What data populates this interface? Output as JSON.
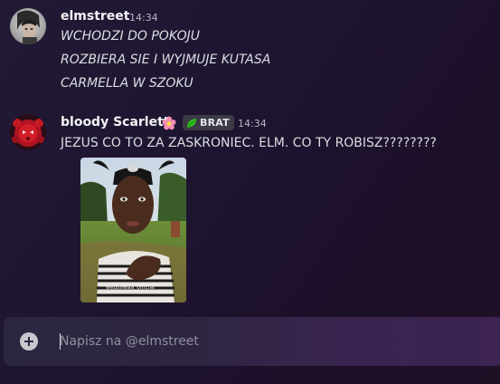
{
  "messages": [
    {
      "author": "elmstreet",
      "time": "14:34",
      "lines": [
        "WCHODZI DO POKOJU",
        "ROZBIERA SIE I WYJMUJE KUTASA",
        "CARMELLA W SZOKU"
      ]
    },
    {
      "author": "bloody Scarlett",
      "time": "14:34",
      "decoration_icon": "flower-icon",
      "tag": {
        "icon": "leaf-icon",
        "label": "BRAT",
        "color": "#2ec41a"
      },
      "lines": [
        "JEZUS CO TO ZA ZASKRONIEC. ELM. CO TY ROBISZ????????"
      ],
      "attachment": {
        "kind": "image",
        "watermark": "wedsilwaa_official"
      }
    }
  ],
  "composer": {
    "placeholder": "Napisz na @elmstreet",
    "value": "",
    "add_icon": "plus-circle-icon"
  },
  "colors": {
    "username": "#f2f3f5",
    "text": "#dbdee1",
    "timestamp": "#b5b8bf",
    "tag_background": "#3b3a45"
  }
}
